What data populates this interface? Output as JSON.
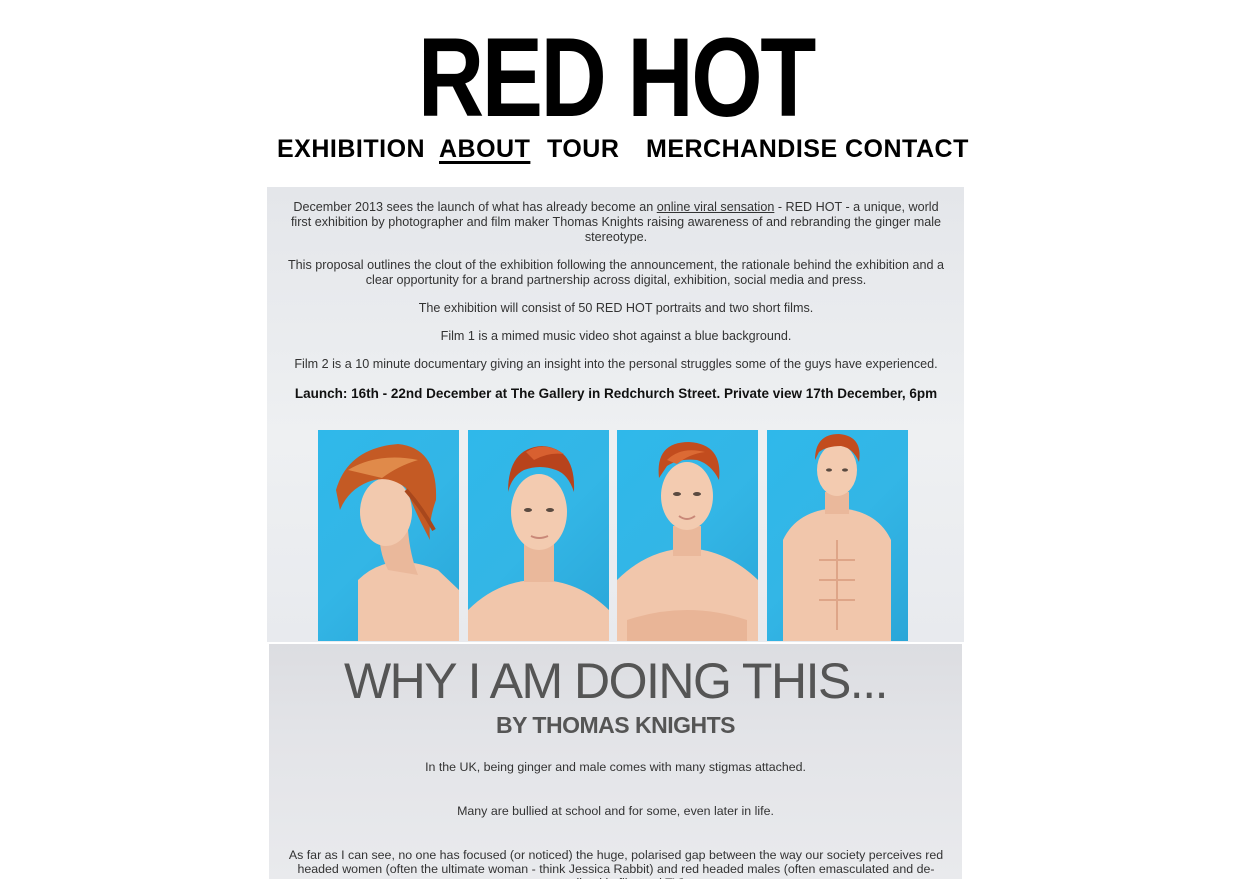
{
  "site": {
    "logo": "RED HOT"
  },
  "nav": {
    "items": [
      {
        "label": "EXHIBITION"
      },
      {
        "label": "ABOUT"
      },
      {
        "label": "TOUR"
      },
      {
        "label": "MERCHANDISE"
      },
      {
        "label": "CONTACT"
      }
    ],
    "active": "ABOUT"
  },
  "intro": {
    "p1_before": "December 2013 sees the launch of what has already become an ",
    "p1_link": "online viral sensation",
    "p1_after": " - RED HOT - a unique, world first exhibition by photographer and film maker Thomas Knights raising awareness of and rebranding the ginger male stereotype.",
    "p2": "This proposal outlines the clout of the exhibition following the announcement, the rationale behind the exhibition and a clear opportunity for a brand partnership across digital, exhibition, social media and press.",
    "p3": "The exhibition will consist of 50 RED HOT portraits and two short films.",
    "p4": "Film 1 is a mimed music video shot against a blue background.",
    "p5": "Film 2 is a 10 minute documentary giving an insight into the personal struggles some of the guys have experienced.",
    "launch": "Launch: 16th - 22nd December at The Gallery in Redchurch Street. Private view 17th December, 6pm"
  },
  "gallery": {
    "background_color": "#33b6e6",
    "hair_color": "#b8431c",
    "skin_color": "#f0c3a8"
  },
  "why": {
    "title": "WHY I AM DOING THIS...",
    "subtitle": "BY THOMAS KNIGHTS",
    "p1": "In the UK, being ginger and male comes with many stigmas attached.",
    "p2": "Many are bullied at school and for some, even later in life.",
    "p3": "As far as I can see, no one has focused (or noticed) the huge, polarised gap between the way our society perceives red headed women (often the ultimate woman - think Jessica Rabbit) and red headed males (often emasculated and de-sexualised in film and TV)."
  }
}
